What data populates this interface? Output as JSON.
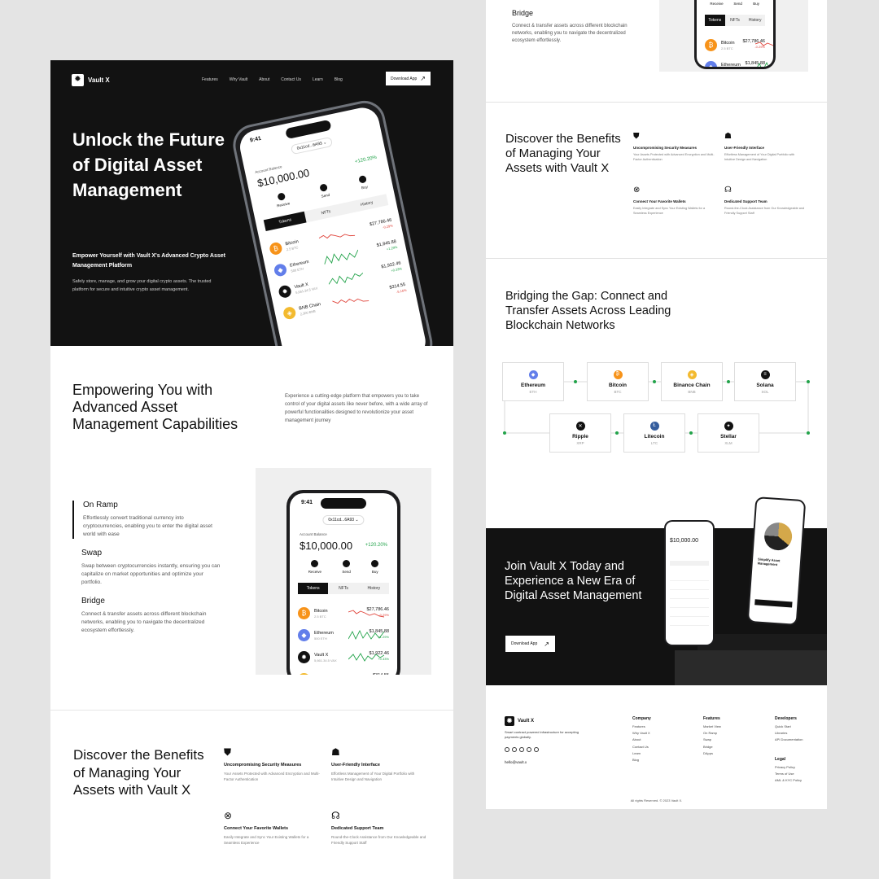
{
  "brand": {
    "name": "Vault X"
  },
  "nav": {
    "links": [
      "Features",
      "Why Vault",
      "About",
      "Contact Us",
      "Learn",
      "Blog"
    ],
    "download_label": "Download App"
  },
  "hero": {
    "title": "Unlock the Future of Digital Asset Management",
    "subtitle": "Empower Yourself with Vault X's Advanced Crypto Asset Management Platform",
    "description": "Safely store, manage, and grow your digital crypto assets. The trusted platform for secure and intuitive crypto asset management."
  },
  "phone": {
    "time": "9:41",
    "address": "0x11cd...6A93",
    "balance_label": "Account Balance",
    "balance": "$10,000.00",
    "change": "+120.20%",
    "actions": [
      "Receive",
      "Send",
      "Buy"
    ],
    "tabs": [
      "Tokens",
      "NFTs",
      "History"
    ],
    "tokens": [
      {
        "name": "Bitcoin",
        "amount": "2.5 BTC",
        "value": "$27,786.46",
        "change": "-0.29%",
        "color": "#f7931a"
      },
      {
        "name": "Ethereum",
        "amount": "500 ETH",
        "value": "$1,845.88",
        "change": "+1.29%",
        "color": "#627eea"
      },
      {
        "name": "Vault X",
        "amount": "5,661.34.5 VAX",
        "value": "$1,922.46",
        "change": "+0.33%",
        "color": "#111111"
      },
      {
        "name": "BNB Chain",
        "amount": "2,300 BNB",
        "value": "$314.55",
        "change": "-5.16%",
        "color": "#f3ba2f"
      }
    ]
  },
  "capabilities": {
    "title": "Empowering You with Advanced Asset Management Capabilities",
    "description": "Experience a cutting-edge platform that empowers you to take control of your digital assets like never before, with a wide array of powerful functionalities designed to revolutionize your asset management journey",
    "features": [
      {
        "title": "On Ramp",
        "text": "Effortlessly convert traditional currency into cryptocurrencies, enabling you to enter the digital asset world with ease"
      },
      {
        "title": "Swap",
        "text": "Swap between cryptocurrencies instantly, ensuring you can capitalize on market opportunities and optimize your portfolio."
      },
      {
        "title": "Bridge",
        "text": "Connect & transfer assets across different blockchain networks, enabling you to navigate the decentralized ecosystem effortlessly."
      }
    ]
  },
  "benefits": {
    "title": "Discover the Benefits of Managing Your Assets with Vault X",
    "items": [
      {
        "title": "Uncompromising Security Measures",
        "text": "Your Assets Protected with Advanced Encryption and Multi-Factor Authentication",
        "icon": "shield-icon"
      },
      {
        "title": "User-Friendly Interface",
        "text": "Effortless Management of Your Digital Portfolio with Intuitive Design and Navigation",
        "icon": "users-icon"
      },
      {
        "title": "Connect Your Favorite Wallets",
        "text": "Easily Integrate and Sync Your Existing Wallets for a Seamless Experience",
        "icon": "link-icon"
      },
      {
        "title": "Dedicated Support Team",
        "text": "Round-the-Clock Assistance from Our Knowledgeable and Friendly Support Staff",
        "icon": "headphones-icon"
      }
    ]
  },
  "right_top": {
    "heading": "Bridge",
    "text": "Connect & transfer assets across different blockchain networks, enabling you to navigate the decentralized ecosystem effortlessly."
  },
  "chains": {
    "title": "Bridging the Gap: Connect and Transfer Assets Across Leading Blockchain Networks",
    "items": [
      {
        "name": "Ethereum",
        "ticker": "ETH",
        "color": "#627eea"
      },
      {
        "name": "Bitcoin",
        "ticker": "BTC",
        "color": "#f7931a"
      },
      {
        "name": "Binance Chain",
        "ticker": "BNB",
        "color": "#f3ba2f"
      },
      {
        "name": "Solana",
        "ticker": "SOL",
        "color": "#111111"
      },
      {
        "name": "Ripple",
        "ticker": "XRP",
        "color": "#111111"
      },
      {
        "name": "Litecoin",
        "ticker": "LTC",
        "color": "#345d9d"
      },
      {
        "name": "Stellar",
        "ticker": "XLM",
        "color": "#111111"
      }
    ],
    "line_color": "#22a34a"
  },
  "cta": {
    "title": "Join Vault X Today and Experience a New Era of Digital Asset Management",
    "button": "Download App",
    "phone_caption": "Simplify Asset Management"
  },
  "footer": {
    "tagline": "Smart contract powered infrastructure for accepting payments globally.",
    "email": "hello@vault.x",
    "columns": [
      {
        "title": "Company",
        "links": [
          "Features",
          "Why Vault X",
          "About",
          "Contact Us",
          "Learn",
          "Blog"
        ]
      },
      {
        "title": "Features",
        "links": [
          "Market View",
          "On Ramp",
          "Swap",
          "Bridge",
          "DApps"
        ]
      },
      {
        "title": "Developers",
        "links": [
          "Quick Start",
          "Libraries",
          "API Documentation"
        ]
      },
      {
        "title": "Legal",
        "links": [
          "Privacy Policy",
          "Terms of Use",
          "AML & KYC Policy"
        ]
      }
    ],
    "copyright": "All rights Reserved. © 2023 Vault X."
  }
}
